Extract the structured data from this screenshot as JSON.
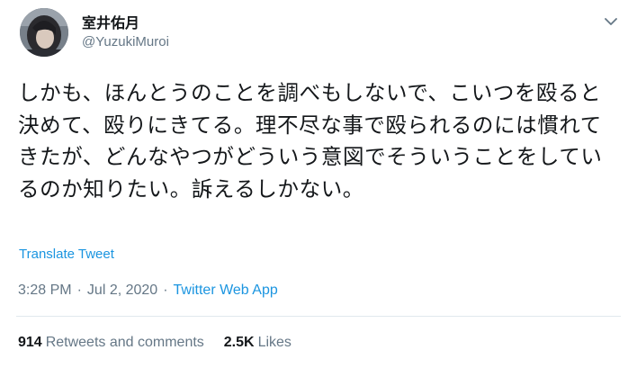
{
  "author": {
    "display_name": "室井佑月",
    "handle": "@YuzukiMuroi"
  },
  "tweet": {
    "text": "しかも、ほんとうのことを調べもしないで、こいつを殴ると決めて、殴りにきてる。理不尽な事で殴られるのには慣れてきたが、どんなやつがどういう意図でそういうことをしているのか知りたい。訴えるしかない。",
    "translate_label": "Translate Tweet"
  },
  "meta": {
    "time": "3:28 PM",
    "date": "Jul 2, 2020",
    "separator": "·",
    "source": "Twitter Web App"
  },
  "stats": {
    "retweets_count": "914",
    "retweets_label": "Retweets and comments",
    "likes_count": "2.5K",
    "likes_label": "Likes"
  },
  "icons": {
    "menu": "chevron-down-icon",
    "avatar": "avatar"
  },
  "colors": {
    "text": "#14171a",
    "secondary": "#657786",
    "link": "#1b95e0",
    "divider": "#e1e8ed"
  }
}
